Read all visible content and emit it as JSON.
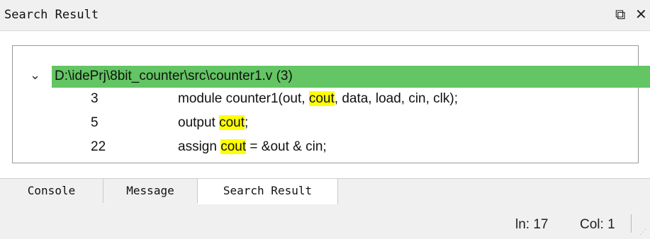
{
  "panel": {
    "title": "Search Result",
    "float_icon": "⧉",
    "close_icon": "✕"
  },
  "results": {
    "file": {
      "expand_icon": "chevron-down-icon",
      "path": "D:\\idePrj\\8bit_counter\\src\\counter1.v (3)"
    },
    "matches": [
      {
        "line": "3",
        "before": "module counter1(out, ",
        "match": "cout",
        "after": ", data, load, cin, clk);"
      },
      {
        "line": "5",
        "before": "output ",
        "match": "cout",
        "after": ";"
      },
      {
        "line": "22",
        "before": "assign ",
        "match": "cout",
        "after": " = &out & cin;"
      }
    ],
    "highlight_color": "#ffff00",
    "file_row_color": "#63c563"
  },
  "tabs": [
    {
      "label": "Console"
    },
    {
      "label": "Message"
    },
    {
      "label": "Search Result",
      "active": true
    }
  ],
  "status": {
    "line": "ln: 17",
    "column": "Col: 1"
  }
}
